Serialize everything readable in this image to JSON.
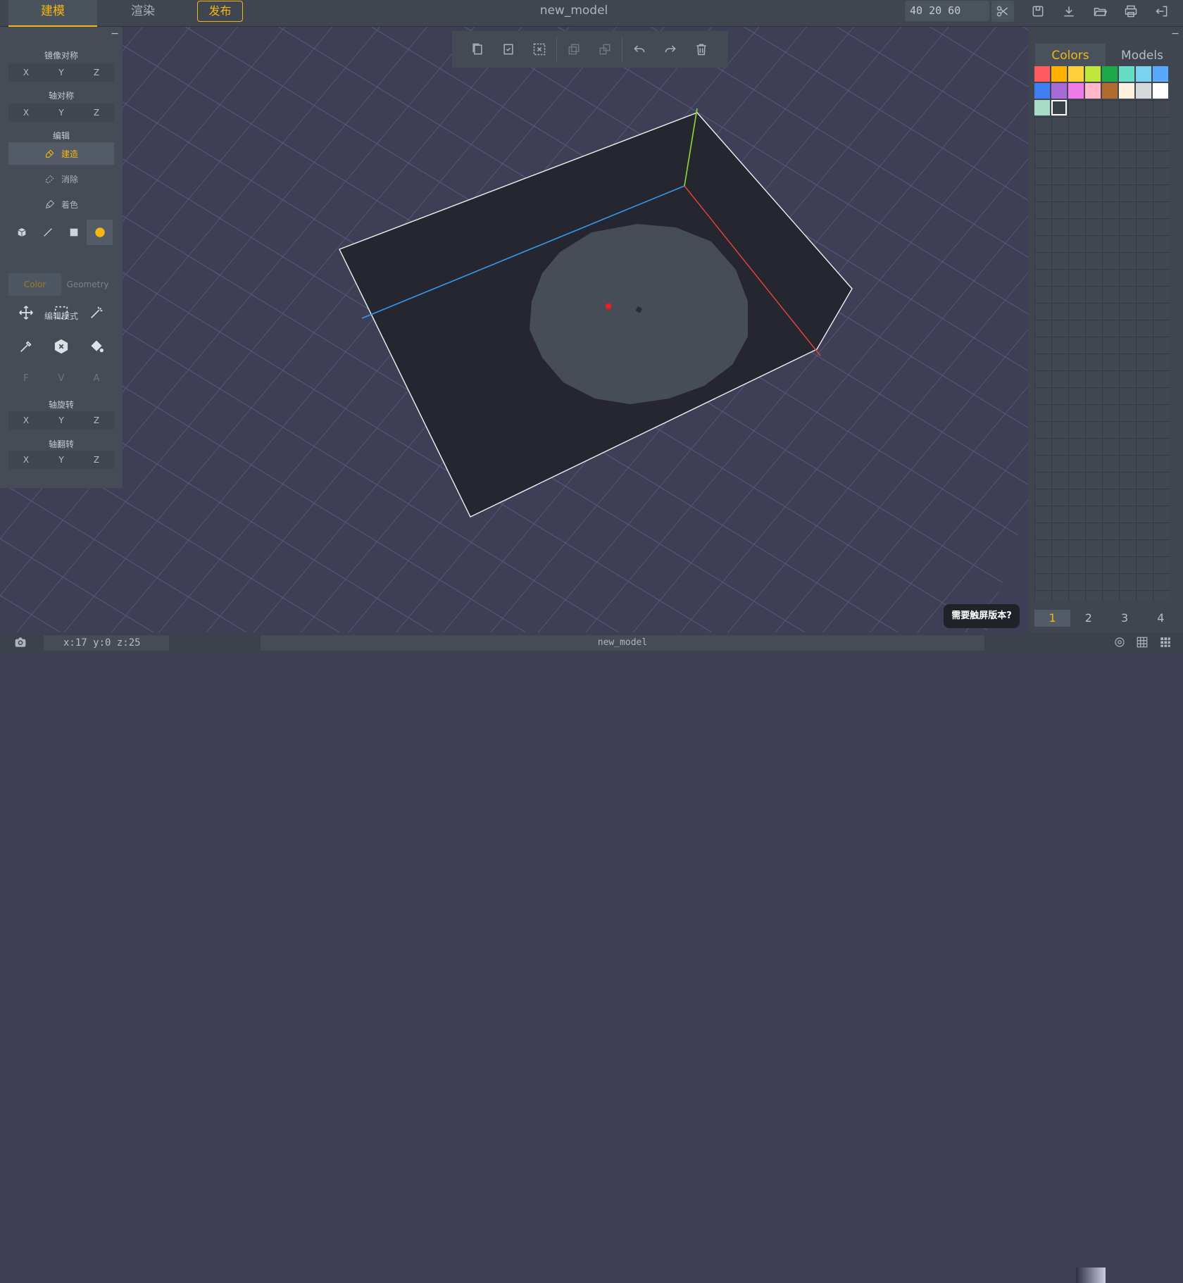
{
  "app": {
    "title": "new_model",
    "dims": "40 20 60"
  },
  "tabs": {
    "build": "建模",
    "render": "渲染",
    "publish": "发布"
  },
  "left": {
    "mirror_title": "镜像对称",
    "axis_sym_title": "轴对称",
    "edit_title": "编辑",
    "tools": {
      "build": "建造",
      "erase": "消除",
      "paint": "着色"
    },
    "subtabs": {
      "color": "Color",
      "geometry": "Geometry"
    },
    "mode_title": "编辑模式",
    "fva": [
      "F",
      "V",
      "A"
    ],
    "rotate_title": "轴旋转",
    "flip_title": "轴翻转",
    "axes": [
      "X",
      "Y",
      "Z"
    ]
  },
  "right": {
    "tab_colors": "Colors",
    "tab_models": "Models",
    "palette": [
      "#ff5a5f",
      "#ffb000",
      "#ffd03a",
      "#bfe63a",
      "#1fa84a",
      "#66ddc4",
      "#7bd2f0",
      "#5aa8ff",
      "#3f7ef5",
      "#a86ad6",
      "#f07ae8",
      "#ffb6c8",
      "#b06c2f",
      "#fdf0de",
      "#d6d9dc",
      "#ffffff",
      "#a8dcc8"
    ],
    "pages": [
      "1",
      "2",
      "3",
      "4"
    ]
  },
  "touch_prompt": "需要触屏版本?",
  "status": {
    "coords": "x:17 y:0 z:25",
    "filename": "new_model"
  },
  "colors": {
    "accent": "#f5b614",
    "x_axis": "#e8453c",
    "y_axis": "#8ddc2c",
    "z_axis": "#2f9bf0",
    "voxel": "#464d57",
    "bounds": "#25252f"
  }
}
